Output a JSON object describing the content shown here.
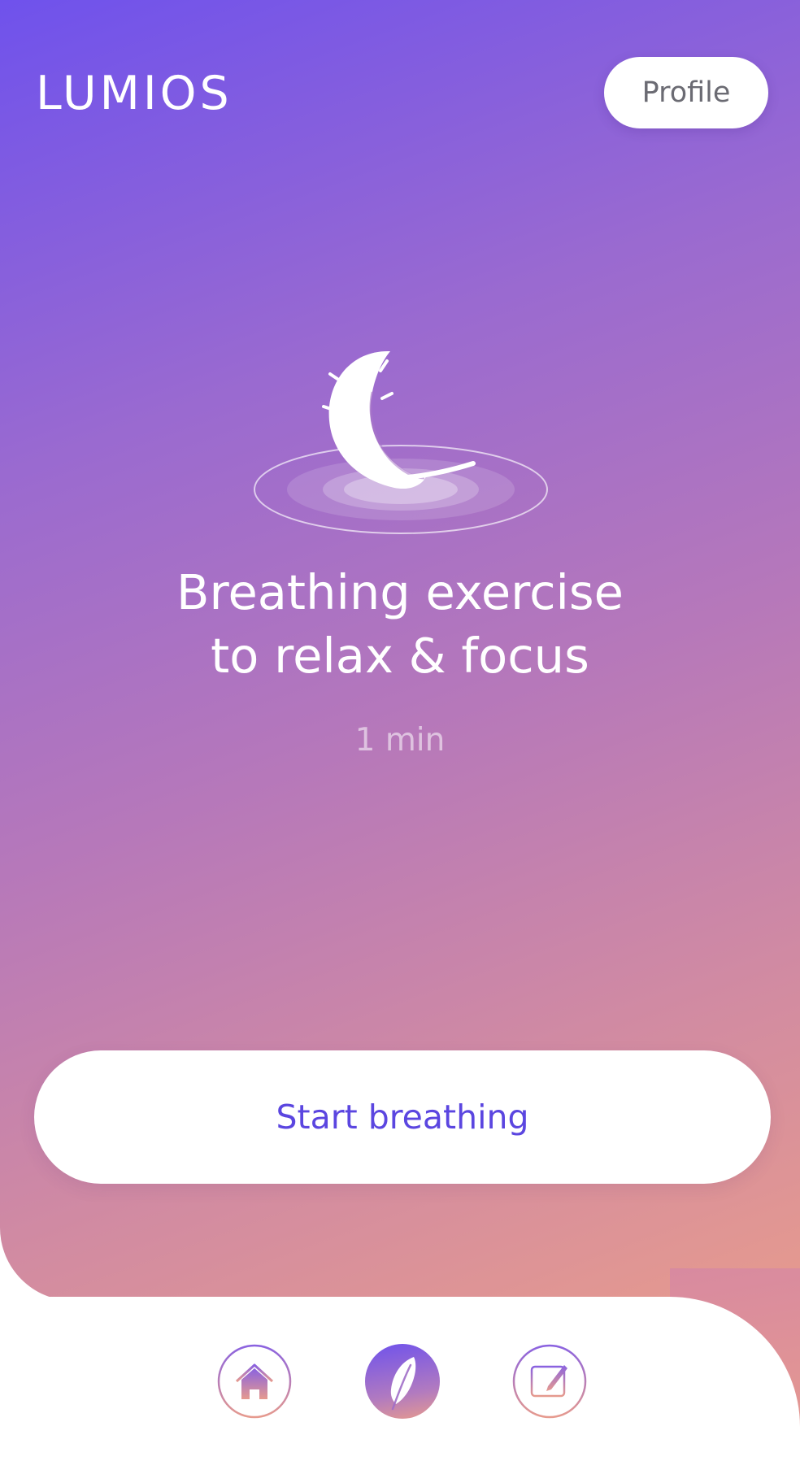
{
  "app": {
    "brand": "LUMIOS"
  },
  "header": {
    "profile_label": "Profile"
  },
  "exercise": {
    "title_line1": "Breathing exercise",
    "title_line2": "to relax & focus",
    "duration": "1 min",
    "illustration_icon": "feather-on-water-icon"
  },
  "actions": {
    "start_label": "Start breathing"
  },
  "bottom_nav": {
    "items": [
      {
        "icon": "home-icon",
        "active": false
      },
      {
        "icon": "feather-icon",
        "active": true
      },
      {
        "icon": "journal-icon",
        "active": false
      }
    ]
  },
  "colors": {
    "gradient_start": "#6f52ec",
    "gradient_end": "#e69a8e",
    "accent": "#5b46e0",
    "surface": "#ffffff"
  }
}
